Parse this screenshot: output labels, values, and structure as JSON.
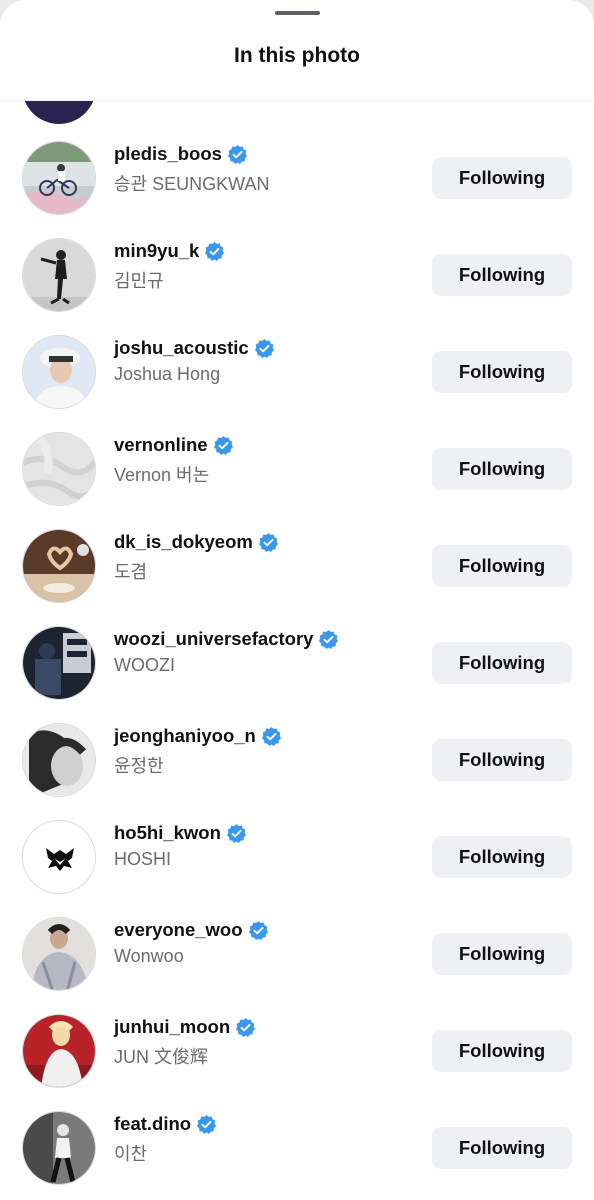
{
  "header": {
    "title": "In this photo"
  },
  "colors": {
    "verified": "#3897f0",
    "button_bg": "#eef0f3"
  },
  "users": [
    {
      "username": "pledis_boos",
      "full_name": "승관 SEUNGKWAN",
      "verified": true,
      "button": "Following",
      "avatar": "photo-cyclist"
    },
    {
      "username": "min9yu_k",
      "full_name": "김민규",
      "verified": true,
      "button": "Following",
      "avatar": "photo-standing-person"
    },
    {
      "username": "joshu_acoustic",
      "full_name": "Joshua Hong",
      "verified": true,
      "button": "Following",
      "avatar": "photo-portrait-hat"
    },
    {
      "username": "vernonline",
      "full_name": "Vernon 버논",
      "verified": true,
      "button": "Following",
      "avatar": "photo-white-fabric"
    },
    {
      "username": "dk_is_dokyeom",
      "full_name": "도겸",
      "verified": true,
      "button": "Following",
      "avatar": "photo-heart-hands"
    },
    {
      "username": "woozi_universefactory",
      "full_name": "WOOZI",
      "verified": true,
      "button": "Following",
      "avatar": "photo-dark-poster"
    },
    {
      "username": "jeonghaniyoo_n",
      "full_name": "윤정한",
      "verified": true,
      "button": "Following",
      "avatar": "photo-bw-portrait"
    },
    {
      "username": "ho5hi_kwon",
      "full_name": "HOSHI",
      "verified": true,
      "button": "Following",
      "avatar": "tiger-logo"
    },
    {
      "username": "everyone_woo",
      "full_name": "Wonwoo",
      "verified": true,
      "button": "Following",
      "avatar": "photo-jacket"
    },
    {
      "username": "junhui_moon",
      "full_name": "JUN 文俊辉",
      "verified": true,
      "button": "Following",
      "avatar": "photo-red-scene"
    },
    {
      "username": "feat.dino",
      "full_name": "이찬",
      "verified": true,
      "button": "Following",
      "avatar": "photo-bw-dancer"
    }
  ]
}
